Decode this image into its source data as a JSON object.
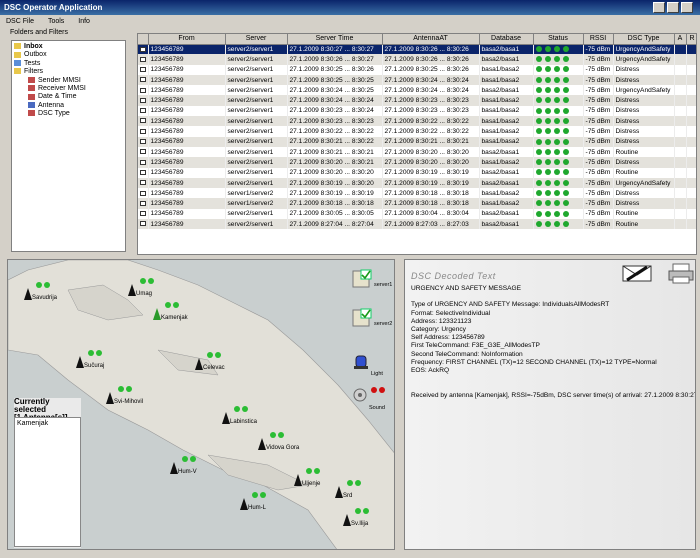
{
  "app": {
    "title": "DSC Operator Application"
  },
  "menu": [
    "DSC File",
    "Tools",
    "Info"
  ],
  "folders": {
    "caption": "Folders and Filters",
    "items": [
      "Inbox",
      "Outbox",
      "Tests",
      "Filters",
      "Sender MMSI",
      "Receiver MMSI",
      "Date & Time",
      "Antenna",
      "DSC Type"
    ]
  },
  "columns": [
    "",
    "From",
    "Server",
    "Server Time",
    "AntennaAT",
    "Database",
    "Status",
    "RSSI",
    "DSC Type",
    "A",
    "R"
  ],
  "rows": [
    [
      "123456789",
      "server2/server1",
      "27.1.2009 8:30:27 ... 8:30:27",
      "27.1.2009 8:30:26 ... 8:30:26",
      "basa2/basa1",
      "-75 dBm",
      "UrgencyAndSafety"
    ],
    [
      "123456789",
      "server2/server1",
      "27.1.2009 8:30:26 ... 8:30:27",
      "27.1.2009 8:30:26 ... 8:30:26",
      "basa2/basa1",
      "-75 dBm",
      "UrgencyAndSafety"
    ],
    [
      "123456789",
      "server2/server1",
      "27.1.2009 8:30:25 ... 8:30:26",
      "27.1.2009 8:30:25 ... 8:30:26",
      "basa1/basa2",
      "-75 dBm",
      "Distress"
    ],
    [
      "123456789",
      "server2/server1",
      "27.1.2009 8:30:25 ... 8:30:25",
      "27.1.2009 8:30:24 ... 8:30:24",
      "basa1/basa2",
      "-75 dBm",
      "Distress"
    ],
    [
      "123456789",
      "server2/server1",
      "27.1.2009 8:30:24 ... 8:30:25",
      "27.1.2009 8:30:24 ... 8:30:24",
      "basa2/basa1",
      "-75 dBm",
      "UrgencyAndSafety"
    ],
    [
      "123456789",
      "server2/server1",
      "27.1.2009 8:30:24 ... 8:30:24",
      "27.1.2009 8:30:23 ... 8:30:23",
      "basa1/basa2",
      "-75 dBm",
      "Distress"
    ],
    [
      "123456789",
      "server2/server1",
      "27.1.2009 8:30:23 ... 8:30:24",
      "27.1.2009 8:30:23 ... 8:30:23",
      "basa1/basa2",
      "-75 dBm",
      "Distress"
    ],
    [
      "123456789",
      "server2/server1",
      "27.1.2009 8:30:23 ... 8:30:23",
      "27.1.2009 8:30:22 ... 8:30:22",
      "basa1/basa2",
      "-75 dBm",
      "Distress"
    ],
    [
      "123456789",
      "server2/server1",
      "27.1.2009 8:30:22 ... 8:30:22",
      "27.1.2009 8:30:22 ... 8:30:22",
      "basa1/basa2",
      "-75 dBm",
      "Distress"
    ],
    [
      "123456789",
      "server2/server1",
      "27.1.2009 8:30:21 ... 8:30:22",
      "27.1.2009 8:30:21 ... 8:30:21",
      "basa1/basa2",
      "-75 dBm",
      "Distress"
    ],
    [
      "123456789",
      "server2/server1",
      "27.1.2009 8:30:21 ... 8:30:21",
      "27.1.2009 8:30:20 ... 8:30:20",
      "basa2/basa1",
      "-75 dBm",
      "Routine"
    ],
    [
      "123456789",
      "server2/server1",
      "27.1.2009 8:30:20 ... 8:30:21",
      "27.1.2009 8:30:20 ... 8:30:20",
      "basa1/basa2",
      "-75 dBm",
      "Distress"
    ],
    [
      "123456789",
      "server2/server1",
      "27.1.2009 8:30:20 ... 8:30:20",
      "27.1.2009 8:30:19 ... 8:30:19",
      "basa2/basa1",
      "-75 dBm",
      "Routine"
    ],
    [
      "123456789",
      "server2/server1",
      "27.1.2009 8:30:19 ... 8:30:20",
      "27.1.2009 8:30:19 ... 8:30:19",
      "basa2/basa1",
      "-75 dBm",
      "UrgencyAndSafety"
    ],
    [
      "123456789",
      "server1/server2",
      "27.1.2009 8:30:19 ... 8:30:19",
      "27.1.2009 8:30:18 ... 8:30:18",
      "basa1/basa2",
      "-75 dBm",
      "Distress"
    ],
    [
      "123456789",
      "server1/server2",
      "27.1.2009 8:30:18 ... 8:30:18",
      "27.1.2009 8:30:18 ... 8:30:18",
      "basa1/basa2",
      "-75 dBm",
      "Distress"
    ],
    [
      "123456789",
      "server2/server1",
      "27.1.2009 8:30:05 ... 8:30:05",
      "27.1.2009 8:30:04 ... 8:30:04",
      "basa2/basa1",
      "-75 dBm",
      "Routine"
    ],
    [
      "123456789",
      "server2/server1",
      "27.1.2009 8:27:04 ... 8:27:04",
      "27.1.2009 8:27:03 ... 8:27:03",
      "basa2/basa1",
      "-75 dBm",
      "Routine"
    ]
  ],
  "antennas": [
    "Umag",
    "Savudrija",
    "Kamenjak",
    "Sučuraj",
    "Celevac",
    "Svi-Mihovil",
    "Labinstica",
    "Vidova Gora",
    "Hum-V",
    "Uljenje",
    "Srd",
    "Hum-L",
    "Sv.Ilija"
  ],
  "servers": [
    "server1",
    "server2"
  ],
  "indicators": [
    "Light",
    "Sound"
  ],
  "selected": {
    "heading": "Currently selected",
    "count": "[1 Antenna[s]]",
    "item": "Kamenjak"
  },
  "decoded": {
    "title": "DSC Decoded Text",
    "lines": [
      "URGENCY AND SAFETY MESSAGE",
      "",
      "Type of URGENCY AND SAFETY Message: IndividualsAllModesRT",
      "Format: SelectiveIndividual",
      "Address: 123321123",
      "Category: Urgency",
      "Self Address: 123456789",
      "First TeleCommand: F3E_G3E_AllModesTP",
      "Second TeleCommand: NoInformation",
      "Frequency: FIRST CHANNEL (TX)=12 SECOND CHANNEL (TX)=12 TYPE=Normal",
      "EOS: AckRQ",
      "",
      "",
      "Received by antenna [Kamenjak], RSSI=-75dBm, DSC server time(s) of arrival: 27.1.2009 8:30:27"
    ]
  },
  "colors": {
    "titlebar": "#0a246a",
    "selection": "#0a246a",
    "status_green": "#1fa82e",
    "alert_red": "#d01010"
  }
}
